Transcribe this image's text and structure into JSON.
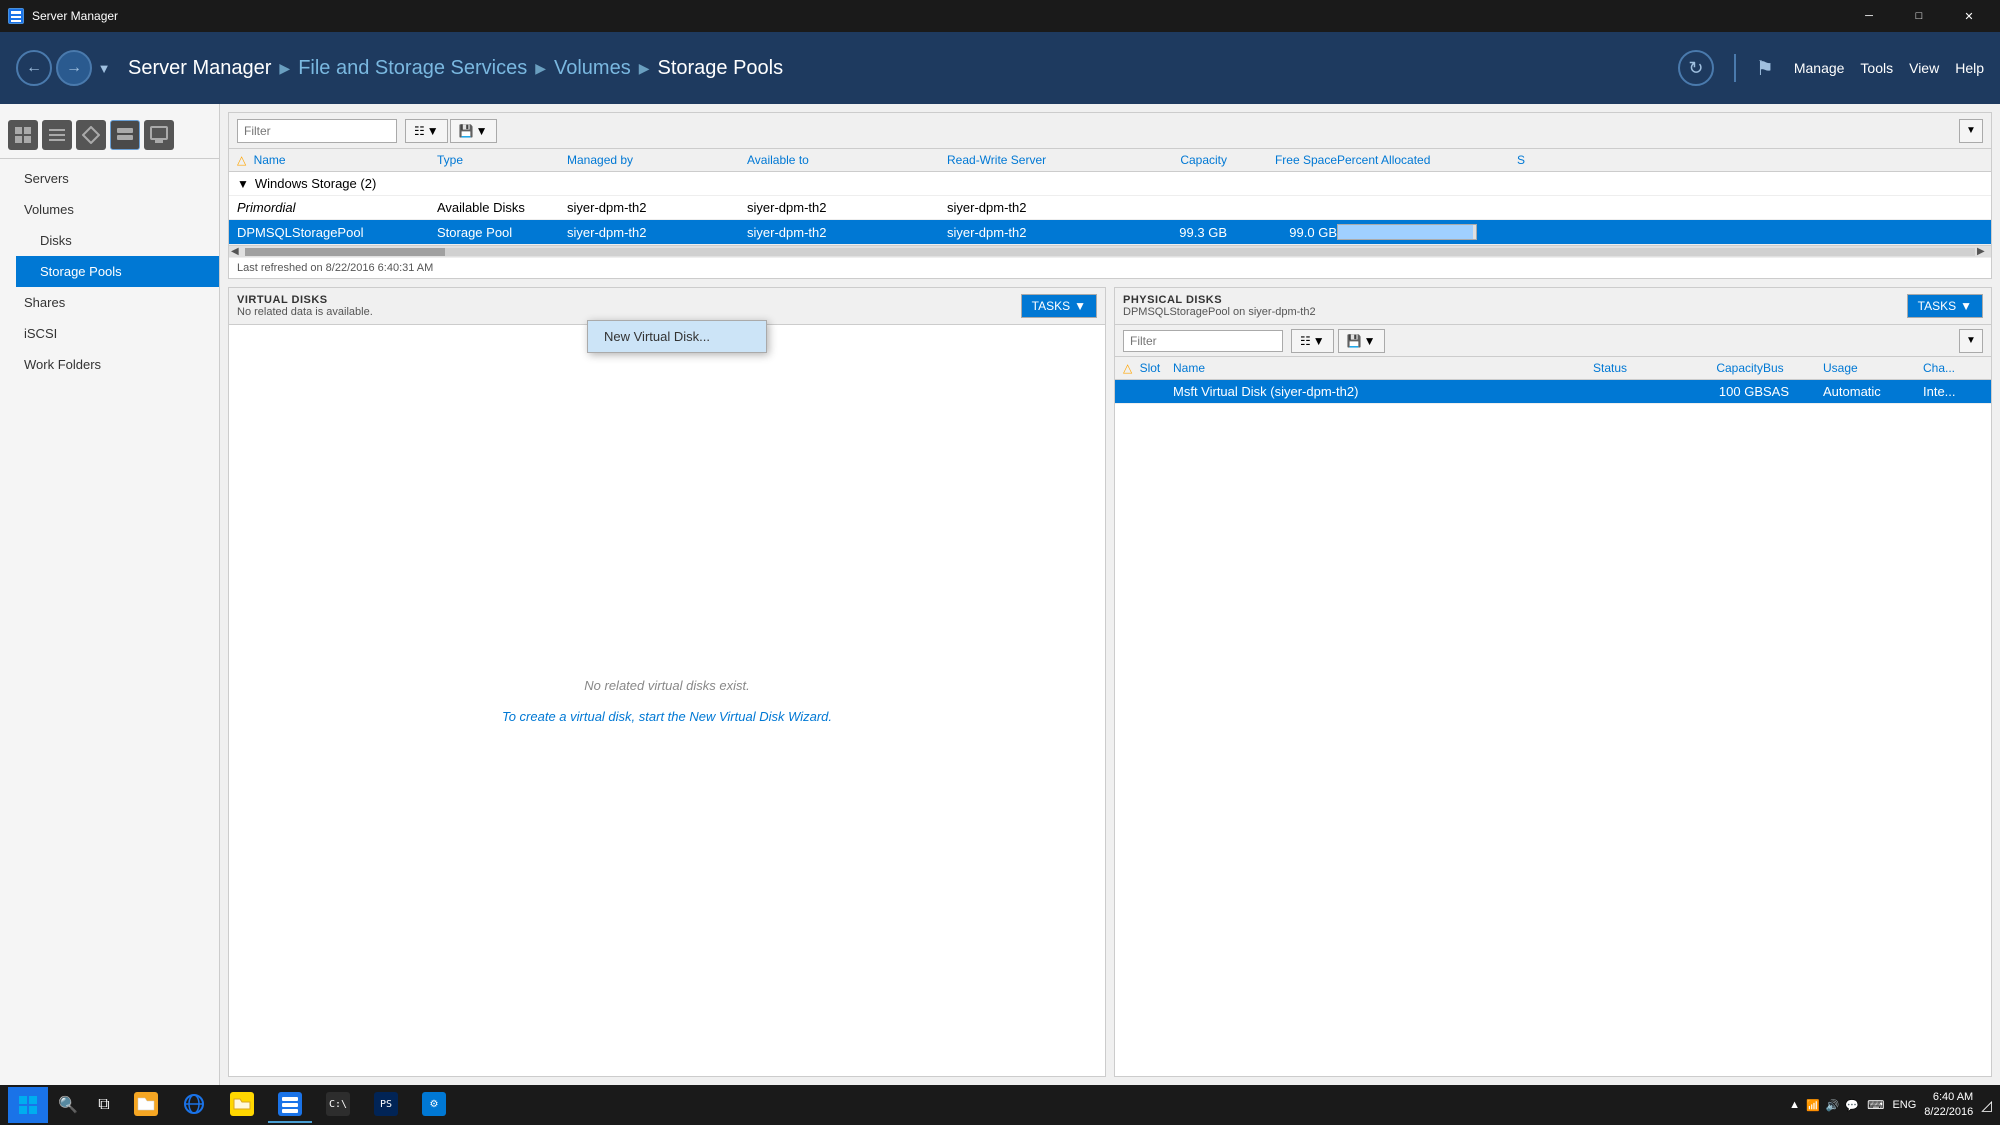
{
  "window": {
    "title": "Server Manager",
    "icon": "server-manager-icon"
  },
  "titlebar": {
    "title": "Server Manager",
    "minimize": "─",
    "maximize": "□",
    "close": "✕"
  },
  "navbar": {
    "breadcrumb": {
      "part1": "Server Manager",
      "sep1": "▶",
      "part2": "File and Storage Services",
      "sep2": "▶",
      "part3": "Volumes",
      "sep3": "▶",
      "part4": "Storage Pools"
    },
    "menus": [
      "Manage",
      "Tools",
      "View",
      "Help"
    ]
  },
  "sidebar": {
    "icons": [
      "⊞",
      "☰",
      "♦",
      "▦",
      "▤"
    ],
    "items": [
      {
        "label": "Servers",
        "id": "servers",
        "active": false
      },
      {
        "label": "Volumes",
        "id": "volumes",
        "active": false
      },
      {
        "label": "Disks",
        "id": "disks",
        "active": false,
        "indent": true
      },
      {
        "label": "Storage Pools",
        "id": "storage-pools",
        "active": true,
        "indent": true
      },
      {
        "label": "Shares",
        "id": "shares",
        "active": false
      },
      {
        "label": "iSCSI",
        "id": "iscsi",
        "active": false
      },
      {
        "label": "Work Folders",
        "id": "work-folders",
        "active": false
      }
    ]
  },
  "storage_pools_table": {
    "filter_placeholder": "Filter",
    "columns": {
      "name": "Name",
      "type": "Type",
      "managed_by": "Managed by",
      "available_to": "Available to",
      "rw_server": "Read-Write Server",
      "capacity": "Capacity",
      "free_space": "Free Space",
      "percent_allocated": "Percent Allocated",
      "status": "S"
    },
    "groups": [
      {
        "group_label": "Windows Storage (2)",
        "rows": [
          {
            "name": "Primordial",
            "type": "Available Disks",
            "managed_by": "siyer-dpm-th2",
            "available_to": "siyer-dpm-th2",
            "rw_server": "siyer-dpm-th2",
            "capacity": "",
            "free_space": "",
            "percent": 0,
            "italic": true,
            "selected": false
          },
          {
            "name": "DPMSQLStoragePool",
            "type": "Storage Pool",
            "managed_by": "siyer-dpm-th2",
            "available_to": "siyer-dpm-th2",
            "rw_server": "siyer-dpm-th2",
            "capacity": "99.3 GB",
            "free_space": "99.0 GB",
            "percent": 98,
            "italic": false,
            "selected": true
          }
        ]
      }
    ],
    "refresh_text": "Last refreshed on 8/22/2016 6:40:31 AM"
  },
  "virtual_disks": {
    "title": "VIRTUAL DISKS",
    "subtitle": "No related data is available.",
    "tasks_btn": "TASKS",
    "empty_text": "No related virtual disks exist.",
    "create_text": "To create a virtual disk, start the New Virtual Disk Wizard.",
    "dropdown": {
      "visible": true,
      "items": [
        "New Virtual Disk..."
      ]
    }
  },
  "physical_disks": {
    "title": "PHYSICAL DISKS",
    "subtitle": "DPMSQLStoragePool on siyer-dpm-th2",
    "tasks_btn": "TASKS",
    "filter_placeholder": "Filter",
    "columns": {
      "slot": "Slot",
      "name": "Name",
      "status": "Status",
      "capacity": "Capacity",
      "bus": "Bus",
      "usage": "Usage",
      "chassis": "Cha..."
    },
    "rows": [
      {
        "slot": "",
        "name": "Msft Virtual Disk (siyer-dpm-th2)",
        "status": "",
        "capacity": "100 GB",
        "bus": "SAS",
        "usage": "Automatic",
        "chassis": "Inte..."
      }
    ]
  },
  "taskbar": {
    "time": "6:40 AM",
    "date": "8/22/2016",
    "language": "ENG",
    "apps": [
      "⊞",
      "🔍",
      "❏",
      "🗀",
      "🌐",
      "📁",
      "📋",
      "▶",
      "⚡",
      "🔧"
    ],
    "systray": [
      "▲",
      "🔊",
      "💬"
    ]
  }
}
